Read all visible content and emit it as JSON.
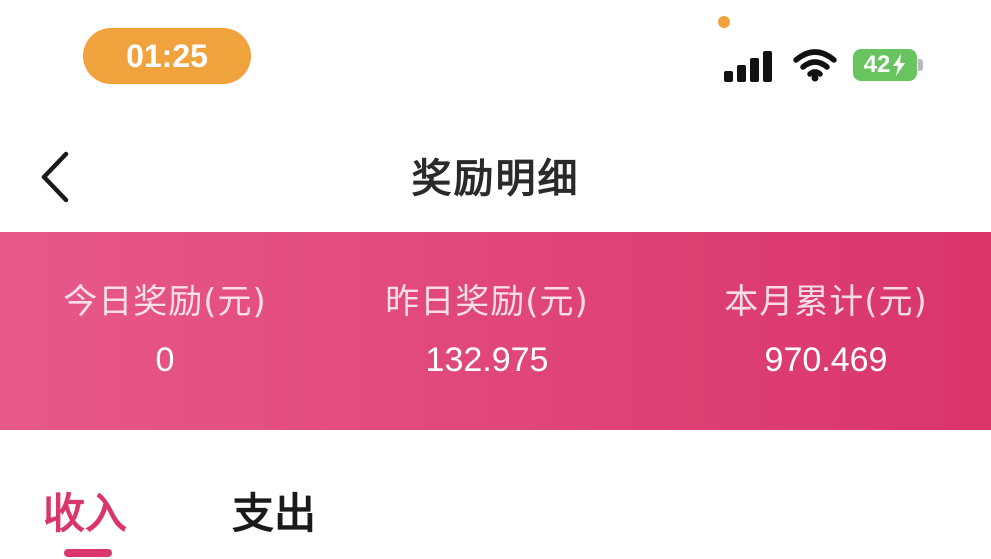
{
  "status_bar": {
    "time": "01:25",
    "battery_level": "42",
    "icons": [
      "signal-icon",
      "wifi-icon",
      "battery-charging-icon"
    ],
    "colors": {
      "time_pill": "#f0a23c",
      "battery": "#67c45f"
    }
  },
  "nav": {
    "title": "奖励明细",
    "back_icon": "chevron-left-icon"
  },
  "summary": {
    "accent": "#e04577",
    "items": [
      {
        "label": "今日奖励(元)",
        "value": "0"
      },
      {
        "label": "昨日奖励(元)",
        "value": "132.975"
      },
      {
        "label": "本月累计(元)",
        "value": "970.469"
      }
    ]
  },
  "tabs": {
    "active_color": "#d9376c",
    "items": [
      {
        "label": "收入",
        "active": true
      },
      {
        "label": "支出",
        "active": false
      }
    ]
  }
}
